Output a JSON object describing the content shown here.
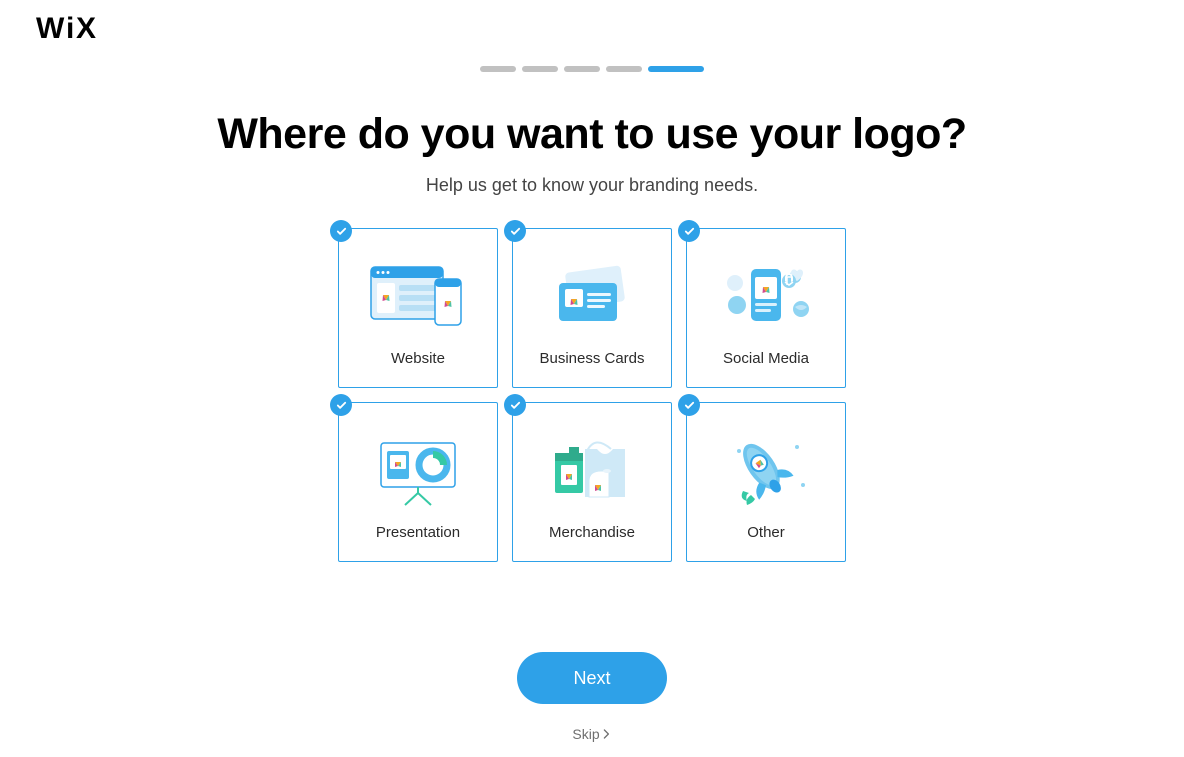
{
  "brand": "WiX",
  "progress": {
    "total": 5,
    "current": 5
  },
  "heading": "Where do you want to use your logo?",
  "subheading": "Help us get to know your branding needs.",
  "cards": [
    {
      "label": "Website",
      "selected": true
    },
    {
      "label": "Business Cards",
      "selected": true
    },
    {
      "label": "Social Media",
      "selected": true
    },
    {
      "label": "Presentation",
      "selected": true
    },
    {
      "label": "Merchandise",
      "selected": true
    },
    {
      "label": "Other",
      "selected": true
    }
  ],
  "buttons": {
    "next": "Next",
    "skip": "Skip"
  },
  "colors": {
    "accent": "#2ea1e8"
  }
}
